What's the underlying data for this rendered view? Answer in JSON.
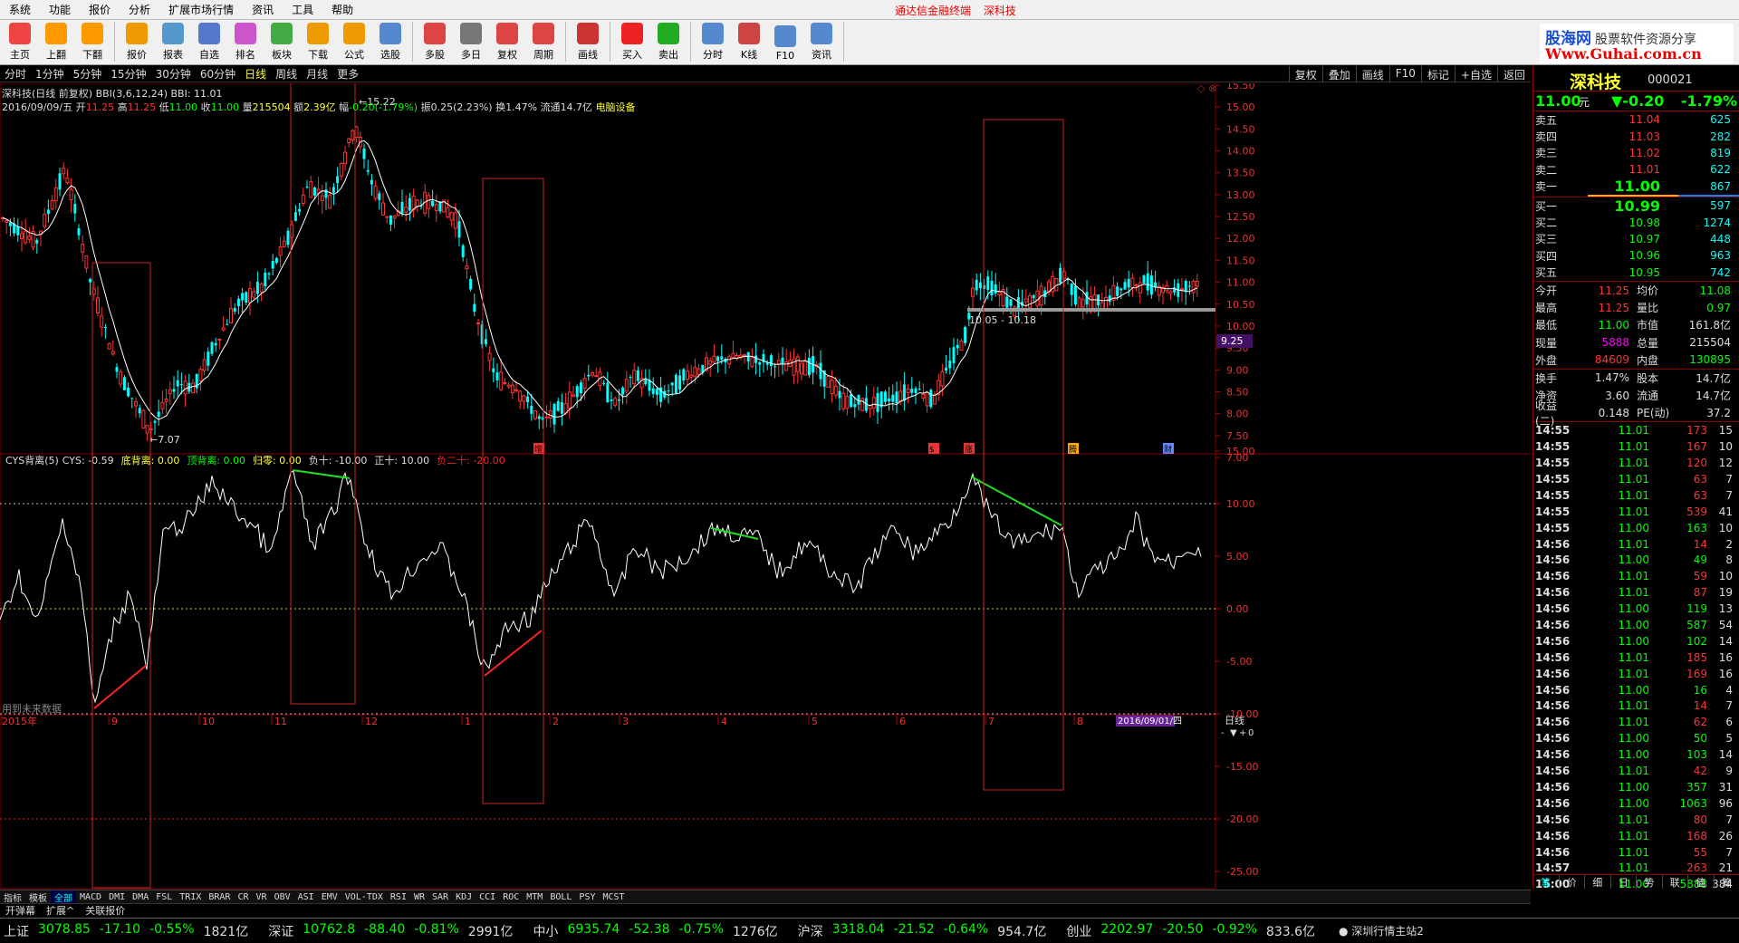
{
  "menu": {
    "items": [
      "系统",
      "功能",
      "报价",
      "分析",
      "扩展市场行情",
      "资讯",
      "工具",
      "帮助"
    ],
    "center_title": "通达信金融终端",
    "center_stock": "深科技"
  },
  "toolbar": {
    "buttons": [
      {
        "label": "主页",
        "icon": "home-icon",
        "color": "#e44"
      },
      {
        "label": "上翻",
        "icon": "up-arrow-icon",
        "color": "#f90"
      },
      {
        "label": "下翻",
        "icon": "down-arrow-icon",
        "color": "#f90"
      },
      {
        "label": "报价",
        "icon": "yen-icon",
        "color": "#e90"
      },
      {
        "label": "报表",
        "icon": "report-icon",
        "color": "#59c"
      },
      {
        "label": "自选",
        "icon": "f6-icon",
        "color": "#57c"
      },
      {
        "label": "排名",
        "icon": "rank-icon",
        "color": "#c5c"
      },
      {
        "label": "板块",
        "icon": "blocks-icon",
        "color": "#4a4"
      },
      {
        "label": "下载",
        "icon": "download-icon",
        "color": "#e90"
      },
      {
        "label": "公式",
        "icon": "formula-icon",
        "color": "#e90"
      },
      {
        "label": "选股",
        "icon": "select-stock-icon",
        "color": "#58c"
      },
      {
        "label": "多股",
        "icon": "multi-stock-icon",
        "color": "#d44"
      },
      {
        "label": "多日",
        "icon": "clock-icon",
        "color": "#777"
      },
      {
        "label": "复权",
        "icon": "adjust-icon",
        "color": "#d44"
      },
      {
        "label": "周期",
        "icon": "f8-icon",
        "color": "#d44"
      },
      {
        "label": "画线",
        "icon": "draw-line-icon",
        "color": "#c33"
      },
      {
        "label": "买入",
        "icon": "buy-icon",
        "color": "#e22"
      },
      {
        "label": "卖出",
        "icon": "sell-icon",
        "color": "#2a2"
      },
      {
        "label": "分时",
        "icon": "intraday-icon",
        "color": "#58c"
      },
      {
        "label": "K线",
        "icon": "kline-icon",
        "color": "#c44"
      },
      {
        "label": "F10",
        "icon": "f10-icon",
        "color": "#58c"
      },
      {
        "label": "资讯",
        "icon": "news-icon",
        "color": "#58c"
      }
    ]
  },
  "logo": {
    "brand1": "股海网",
    "brand2": "股票软件资源分享",
    "url_text": "Www.Guhai.com.cn"
  },
  "periods": {
    "items": [
      "分时",
      "1分钟",
      "5分钟",
      "15分钟",
      "30分钟",
      "60分钟",
      "日线",
      "周线",
      "月线",
      "更多"
    ],
    "active": "日线",
    "right_items": [
      "复权",
      "叠加",
      "画线",
      "F10",
      "标记",
      "+自选",
      "返回"
    ]
  },
  "info": {
    "line1_title": "深科技(日线 前复权)",
    "line1_bbi_params": "BBI(3,6,12,24)",
    "line1_bbi_value": "BBI: 11.01",
    "date": "2016/09/09/五",
    "open_label": "开",
    "open": "11.25",
    "high_label": "高",
    "high": "11.25",
    "low_label": "低",
    "low": "11.00",
    "close_label": "收",
    "close": "11.00",
    "vol_label": "量",
    "vol": "215504",
    "amt_label": "额",
    "amt": "2.39亿",
    "chg_label": "幅",
    "chg": "-0.20(-1.79%)",
    "amp_label": "振",
    "amp": "0.25(2.23%)",
    "turn_label": "换",
    "turn": "1.47%",
    "float_label": "流通",
    "float": "14.7亿",
    "sector": "电脑设备"
  },
  "main_chart": {
    "y_ticks": [
      "15.50",
      "15.00",
      "14.50",
      "14.00",
      "13.50",
      "13.00",
      "12.50",
      "12.00",
      "11.50",
      "11.00",
      "10.50",
      "10.00",
      "9.50",
      "9.00",
      "8.50",
      "8.00",
      "7.50",
      "7.00"
    ],
    "high_marker": "15.22",
    "low_marker": "7.07",
    "range_label": "10.05 - 10.18",
    "current_price_tag": "9.25",
    "event_marks": [
      "增",
      "$",
      "涨",
      "腾",
      "财"
    ]
  },
  "indicator": {
    "title": "CYS背离(5)",
    "cys": "CYS: -0.59",
    "items": [
      {
        "label": "底背离: 0.00",
        "color": "#ff3"
      },
      {
        "label": "顶背离: 0.00",
        "color": "#0f0"
      },
      {
        "label": "归零: 0.00",
        "color": "#ff3"
      },
      {
        "label": "负十: -10.00",
        "color": "#ddd"
      },
      {
        "label": "正十: 10.00",
        "color": "#ddd"
      },
      {
        "label": "负二十: -20.00",
        "color": "#e22"
      }
    ],
    "y_ticks": [
      "15.00",
      "10.00",
      "5.00",
      "0.00",
      "-5.00",
      "-10.00",
      "-15.00",
      "-20.00",
      "-25.00"
    ],
    "note": "用到未来数据"
  },
  "x_axis": {
    "labels": [
      "2015年",
      "9",
      "10",
      "11",
      "12",
      "1",
      "2",
      "3",
      "4",
      "5",
      "6",
      "7",
      "8"
    ],
    "cursor_date": "2016/09/01/四",
    "right_label": "日线"
  },
  "indicator_tabs": {
    "items": [
      "指标",
      "模板",
      "全部",
      "MACD",
      "DMI",
      "DMA",
      "FSL",
      "TRIX",
      "BRAR",
      "CR",
      "VR",
      "OBV",
      "ASI",
      "EMV",
      "VOL-TDX",
      "RSI",
      "WR",
      "SAR",
      "KDJ",
      "CCI",
      "ROC",
      "MTM",
      "BOLL",
      "PSY",
      "MCST"
    ],
    "active": "全部"
  },
  "bottom_tabs": [
    "开弹幕",
    "扩展^",
    "关联报价"
  ],
  "quote": {
    "name": "深科技",
    "code": "000021",
    "price": "11.00",
    "price_unit": "元",
    "change": "▼-0.20",
    "change_pct": "-1.79%",
    "asks": [
      {
        "label": "卖五",
        "price": "11.04",
        "vol": "625"
      },
      {
        "label": "卖四",
        "price": "11.03",
        "vol": "282"
      },
      {
        "label": "卖三",
        "price": "11.02",
        "vol": "819"
      },
      {
        "label": "卖二",
        "price": "11.01",
        "vol": "622"
      },
      {
        "label": "卖一",
        "price": "11.00",
        "vol": "867"
      }
    ],
    "bids": [
      {
        "label": "买一",
        "price": "10.99",
        "vol": "597"
      },
      {
        "label": "买二",
        "price": "10.98",
        "vol": "1274"
      },
      {
        "label": "买三",
        "price": "10.97",
        "vol": "448"
      },
      {
        "label": "买四",
        "price": "10.96",
        "vol": "963"
      },
      {
        "label": "买五",
        "price": "10.95",
        "vol": "742"
      }
    ],
    "stats1": [
      {
        "k": "今开",
        "v": "11.25",
        "vc": "r",
        "k2": "均价",
        "v2": "11.08",
        "v2c": "g"
      },
      {
        "k": "最高",
        "v": "11.25",
        "vc": "r",
        "k2": "量比",
        "v2": "0.97",
        "v2c": "g"
      },
      {
        "k": "最低",
        "v": "11.00",
        "vc": "g",
        "k2": "市值",
        "v2": "161.8亿",
        "v2c": "w"
      },
      {
        "k": "现量",
        "v": "5888",
        "vc": "m",
        "k2": "总量",
        "v2": "215504",
        "v2c": "w"
      },
      {
        "k": "外盘",
        "v": "84609",
        "vc": "r",
        "k2": "内盘",
        "v2": "130895",
        "v2c": "g"
      }
    ],
    "stats2": [
      {
        "k": "换手",
        "v": "1.47%",
        "vc": "w",
        "k2": "股本",
        "v2": "14.7亿",
        "v2c": "w"
      },
      {
        "k": "净资",
        "v": "3.60",
        "vc": "w",
        "k2": "流通",
        "v2": "14.7亿",
        "v2c": "w"
      },
      {
        "k": "收益(二)",
        "v": "0.148",
        "vc": "w",
        "k2": "PE(动)",
        "v2": "37.2",
        "v2c": "w"
      }
    ],
    "ticks": [
      [
        "14:55",
        "11.01",
        "173",
        "15"
      ],
      [
        "14:55",
        "11.01",
        "167",
        "10"
      ],
      [
        "14:55",
        "11.01",
        "120",
        "12"
      ],
      [
        "14:55",
        "11.01",
        "63",
        "7"
      ],
      [
        "14:55",
        "11.01",
        "63",
        "7"
      ],
      [
        "14:55",
        "11.01",
        "539",
        "41"
      ],
      [
        "14:55",
        "11.00",
        "163",
        "10"
      ],
      [
        "14:56",
        "11.01",
        "14",
        "2"
      ],
      [
        "14:56",
        "11.00",
        "49",
        "8"
      ],
      [
        "14:56",
        "11.01",
        "59",
        "10"
      ],
      [
        "14:56",
        "11.01",
        "87",
        "19"
      ],
      [
        "14:56",
        "11.00",
        "119",
        "13"
      ],
      [
        "14:56",
        "11.00",
        "587",
        "54"
      ],
      [
        "14:56",
        "11.00",
        "102",
        "14"
      ],
      [
        "14:56",
        "11.01",
        "185",
        "16"
      ],
      [
        "14:56",
        "11.01",
        "169",
        "16"
      ],
      [
        "14:56",
        "11.00",
        "16",
        "4"
      ],
      [
        "14:56",
        "11.01",
        "14",
        "7"
      ],
      [
        "14:56",
        "11.01",
        "62",
        "6"
      ],
      [
        "14:56",
        "11.00",
        "50",
        "5"
      ],
      [
        "14:56",
        "11.00",
        "103",
        "14"
      ],
      [
        "14:56",
        "11.01",
        "42",
        "9"
      ],
      [
        "14:56",
        "11.00",
        "357",
        "31"
      ],
      [
        "14:56",
        "11.00",
        "1063",
        "96"
      ],
      [
        "14:56",
        "11.01",
        "80",
        "7"
      ],
      [
        "14:56",
        "11.01",
        "168",
        "26"
      ],
      [
        "14:56",
        "11.01",
        "55",
        "7"
      ],
      [
        "14:57",
        "11.01",
        "263",
        "21"
      ],
      [
        "15:00",
        "11.00",
        "5888",
        "384"
      ]
    ],
    "tabs": [
      "笔",
      "价",
      "细",
      "日",
      "势",
      "联",
      "值",
      "筹"
    ]
  },
  "status": {
    "indices": [
      {
        "name": "上证",
        "val": "3078.85",
        "chg": "-17.10",
        "pct": "-0.55%",
        "amt": "1821亿"
      },
      {
        "name": "深证",
        "val": "10762.8",
        "chg": "-88.40",
        "pct": "-0.81%",
        "amt": "2991亿"
      },
      {
        "name": "中小",
        "val": "6935.74",
        "chg": "-52.38",
        "pct": "-0.75%",
        "amt": "1276亿"
      },
      {
        "name": "沪深",
        "val": "3318.04",
        "chg": "-21.52",
        "pct": "-0.64%",
        "amt": "954.7亿"
      },
      {
        "name": "创业",
        "val": "2202.97",
        "chg": "-20.50",
        "pct": "-0.92%",
        "amt": "833.6亿"
      }
    ],
    "server": "深圳行情主站2"
  },
  "colors": {
    "up": "#ff3333",
    "down": "#00ffff",
    "bbi": "#ffffff",
    "frame": "#cc2222",
    "top_divergence": "#22dd22",
    "bottom_divergence": "#ff2222"
  }
}
